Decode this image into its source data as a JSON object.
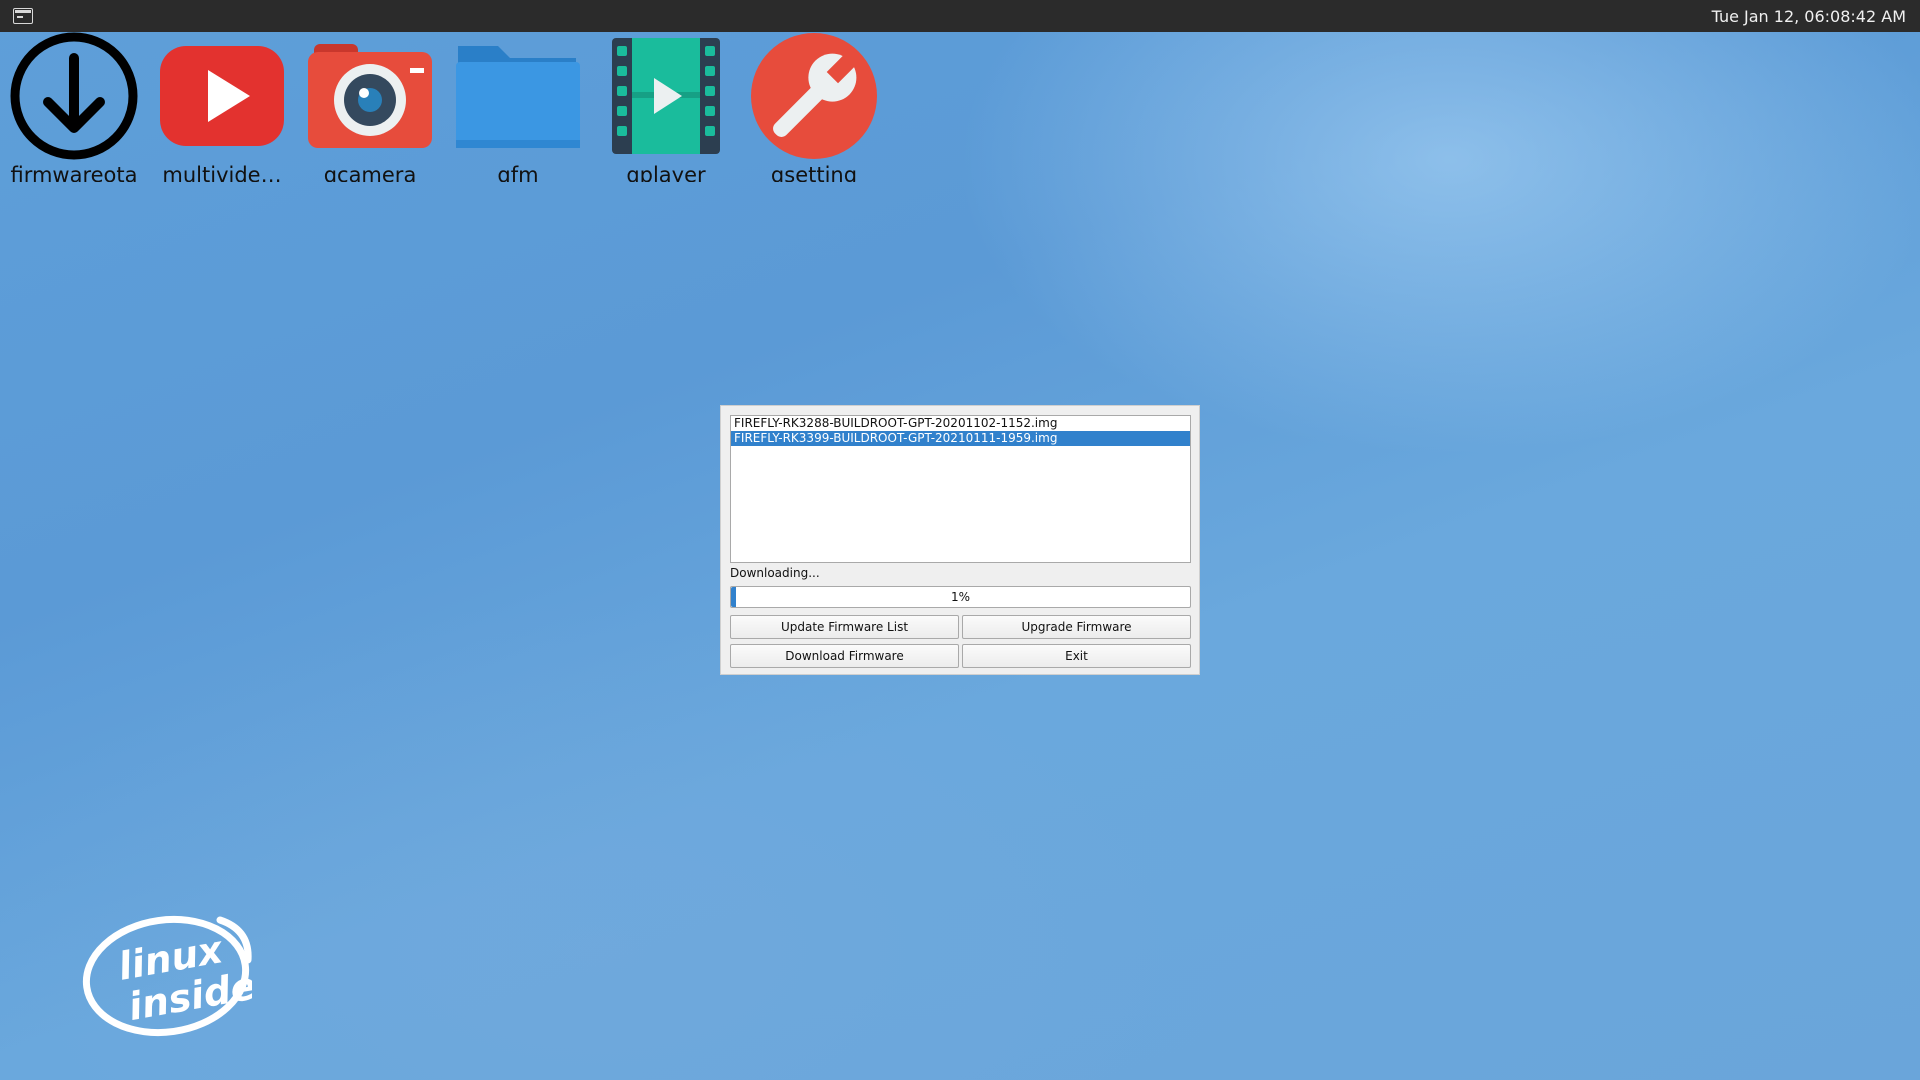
{
  "topbar": {
    "clock": "Tue Jan 12, 06:08:42 AM",
    "icon": "terminal-icon"
  },
  "desktop_icons": [
    {
      "label": "firmwareota",
      "icon": "download-arrow-icon"
    },
    {
      "label": "multivide…",
      "icon": "youtube-play-icon"
    },
    {
      "label": "qcamera",
      "icon": "camera-icon"
    },
    {
      "label": "qfm",
      "icon": "folder-icon"
    },
    {
      "label": "qplayer",
      "icon": "film-play-icon"
    },
    {
      "label": "qsetting",
      "icon": "wrench-icon"
    }
  ],
  "dialog": {
    "firmware_list": [
      {
        "name": "FIREFLY-RK3288-BUILDROOT-GPT-20201102-1152.img",
        "selected": false
      },
      {
        "name": "FIREFLY-RK3399-BUILDROOT-GPT-20210111-1959.img",
        "selected": true
      }
    ],
    "status": "Downloading...",
    "progress": {
      "value": 1,
      "label": "1%"
    },
    "buttons": {
      "update_list": "Update Firmware List",
      "upgrade": "Upgrade Firmware",
      "download": "Download Firmware",
      "exit": "Exit"
    }
  },
  "colors": {
    "selection": "#3181cc",
    "topbar": "#2b2b2b",
    "desktop": "#5e9fd9"
  }
}
